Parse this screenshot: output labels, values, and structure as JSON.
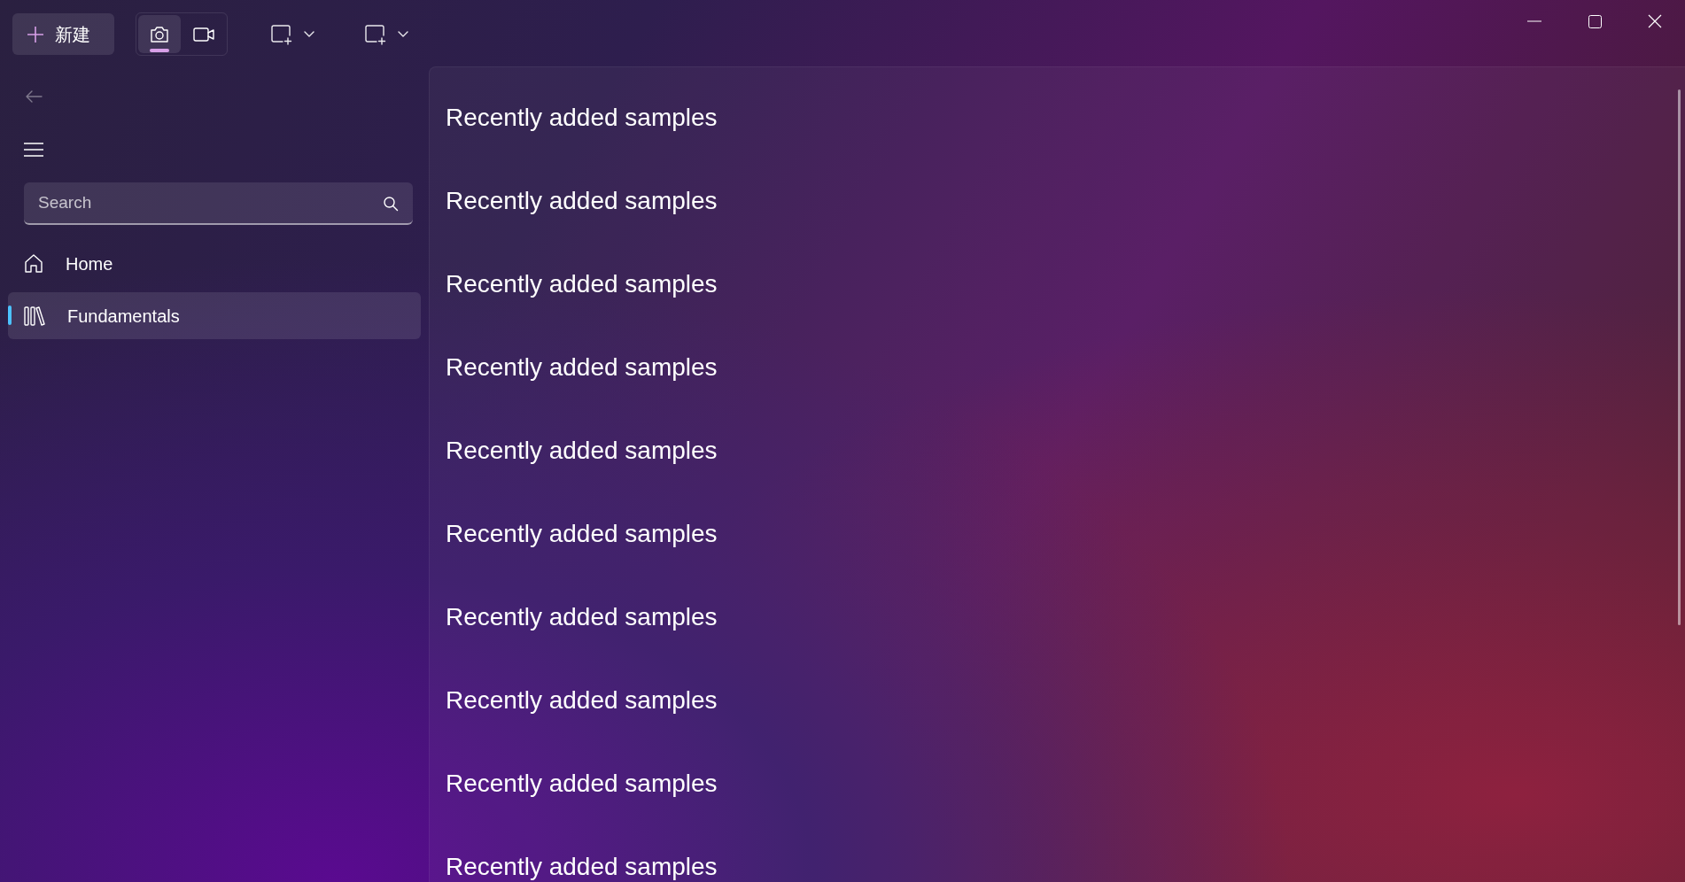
{
  "toolbar": {
    "new_button": {
      "label": "新建"
    },
    "capture_modes": [
      {
        "kind": "photo",
        "selected": true
      },
      {
        "kind": "video",
        "selected": false
      }
    ]
  },
  "sidebar": {
    "search": {
      "placeholder": "Search"
    },
    "items": [
      {
        "kind": "home",
        "label": "Home",
        "selected": false
      },
      {
        "kind": "library",
        "label": "Fundamentals",
        "selected": true
      }
    ]
  },
  "content": {
    "headings": [
      "Recently added samples",
      "Recently added samples",
      "Recently added samples",
      "Recently added samples",
      "Recently added samples",
      "Recently added samples",
      "Recently added samples",
      "Recently added samples",
      "Recently added samples",
      "Recently added samples"
    ]
  }
}
